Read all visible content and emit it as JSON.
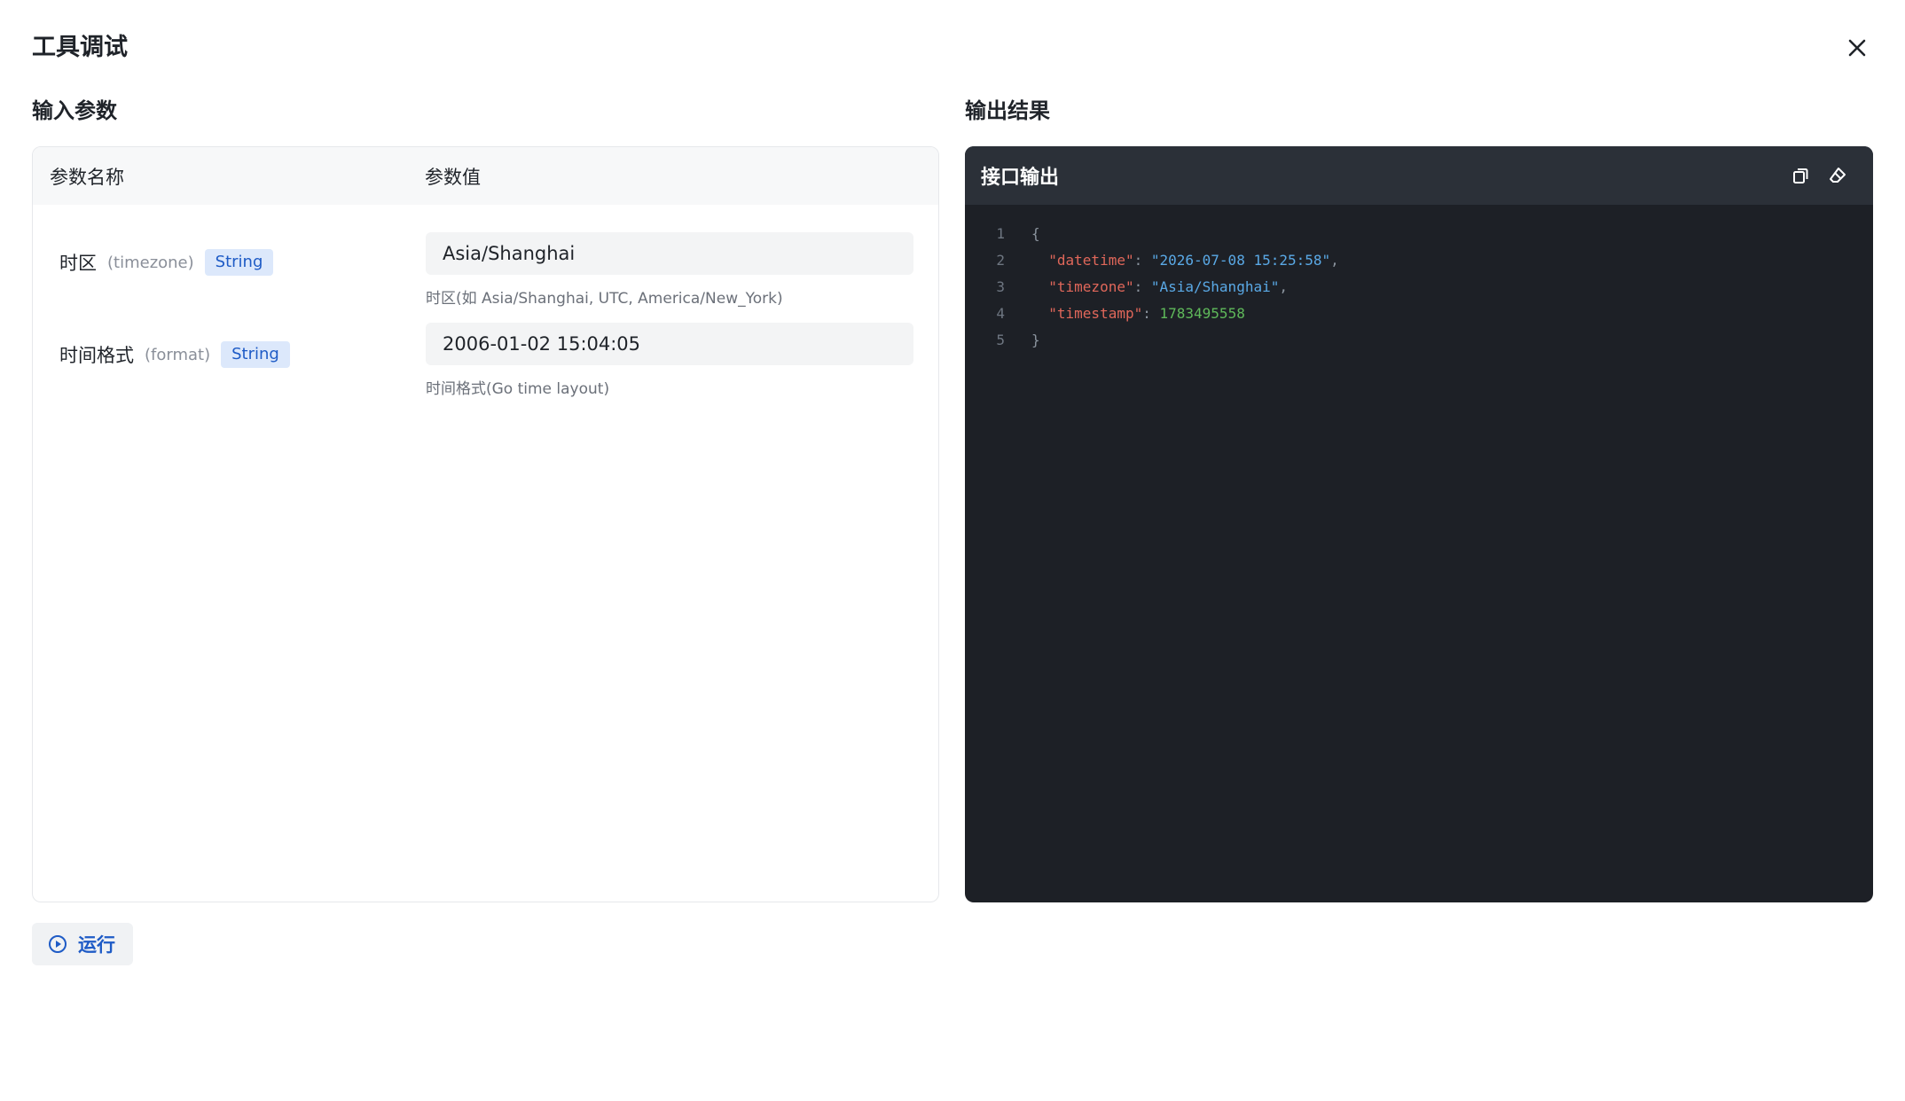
{
  "modal": {
    "title": "工具调试"
  },
  "input": {
    "section_title": "输入参数",
    "col_name": "参数名称",
    "col_value": "参数值",
    "params": [
      {
        "name": "时区",
        "key": "(timezone)",
        "type": "String",
        "value": "Asia/Shanghai",
        "description": "时区(如 Asia/Shanghai, UTC, America/New_York)"
      },
      {
        "name": "时间格式",
        "key": "(format)",
        "type": "String",
        "value": "2006-01-02 15:04:05",
        "description": "时间格式(Go time layout)"
      }
    ]
  },
  "output": {
    "section_title": "输出结果",
    "panel_title": "接口输出",
    "lines": [
      {
        "no": "1",
        "open": "{"
      },
      {
        "no": "2",
        "key": "\"datetime\"",
        "value": "\"2026-07-08 15:25:58\"",
        "sep": ","
      },
      {
        "no": "3",
        "key": "\"timezone\"",
        "value": "\"Asia/Shanghai\"",
        "sep": ","
      },
      {
        "no": "4",
        "key": "\"timestamp\"",
        "value": "1783495558"
      },
      {
        "no": "5",
        "close": "}"
      }
    ]
  },
  "actions": {
    "run_label": "运行"
  },
  "colors": {
    "accent": "#1e5bc6",
    "code_bg": "#1d2026",
    "code_key": "#e0675a",
    "code_string": "#5aa9e6",
    "code_number": "#5fb95a"
  }
}
